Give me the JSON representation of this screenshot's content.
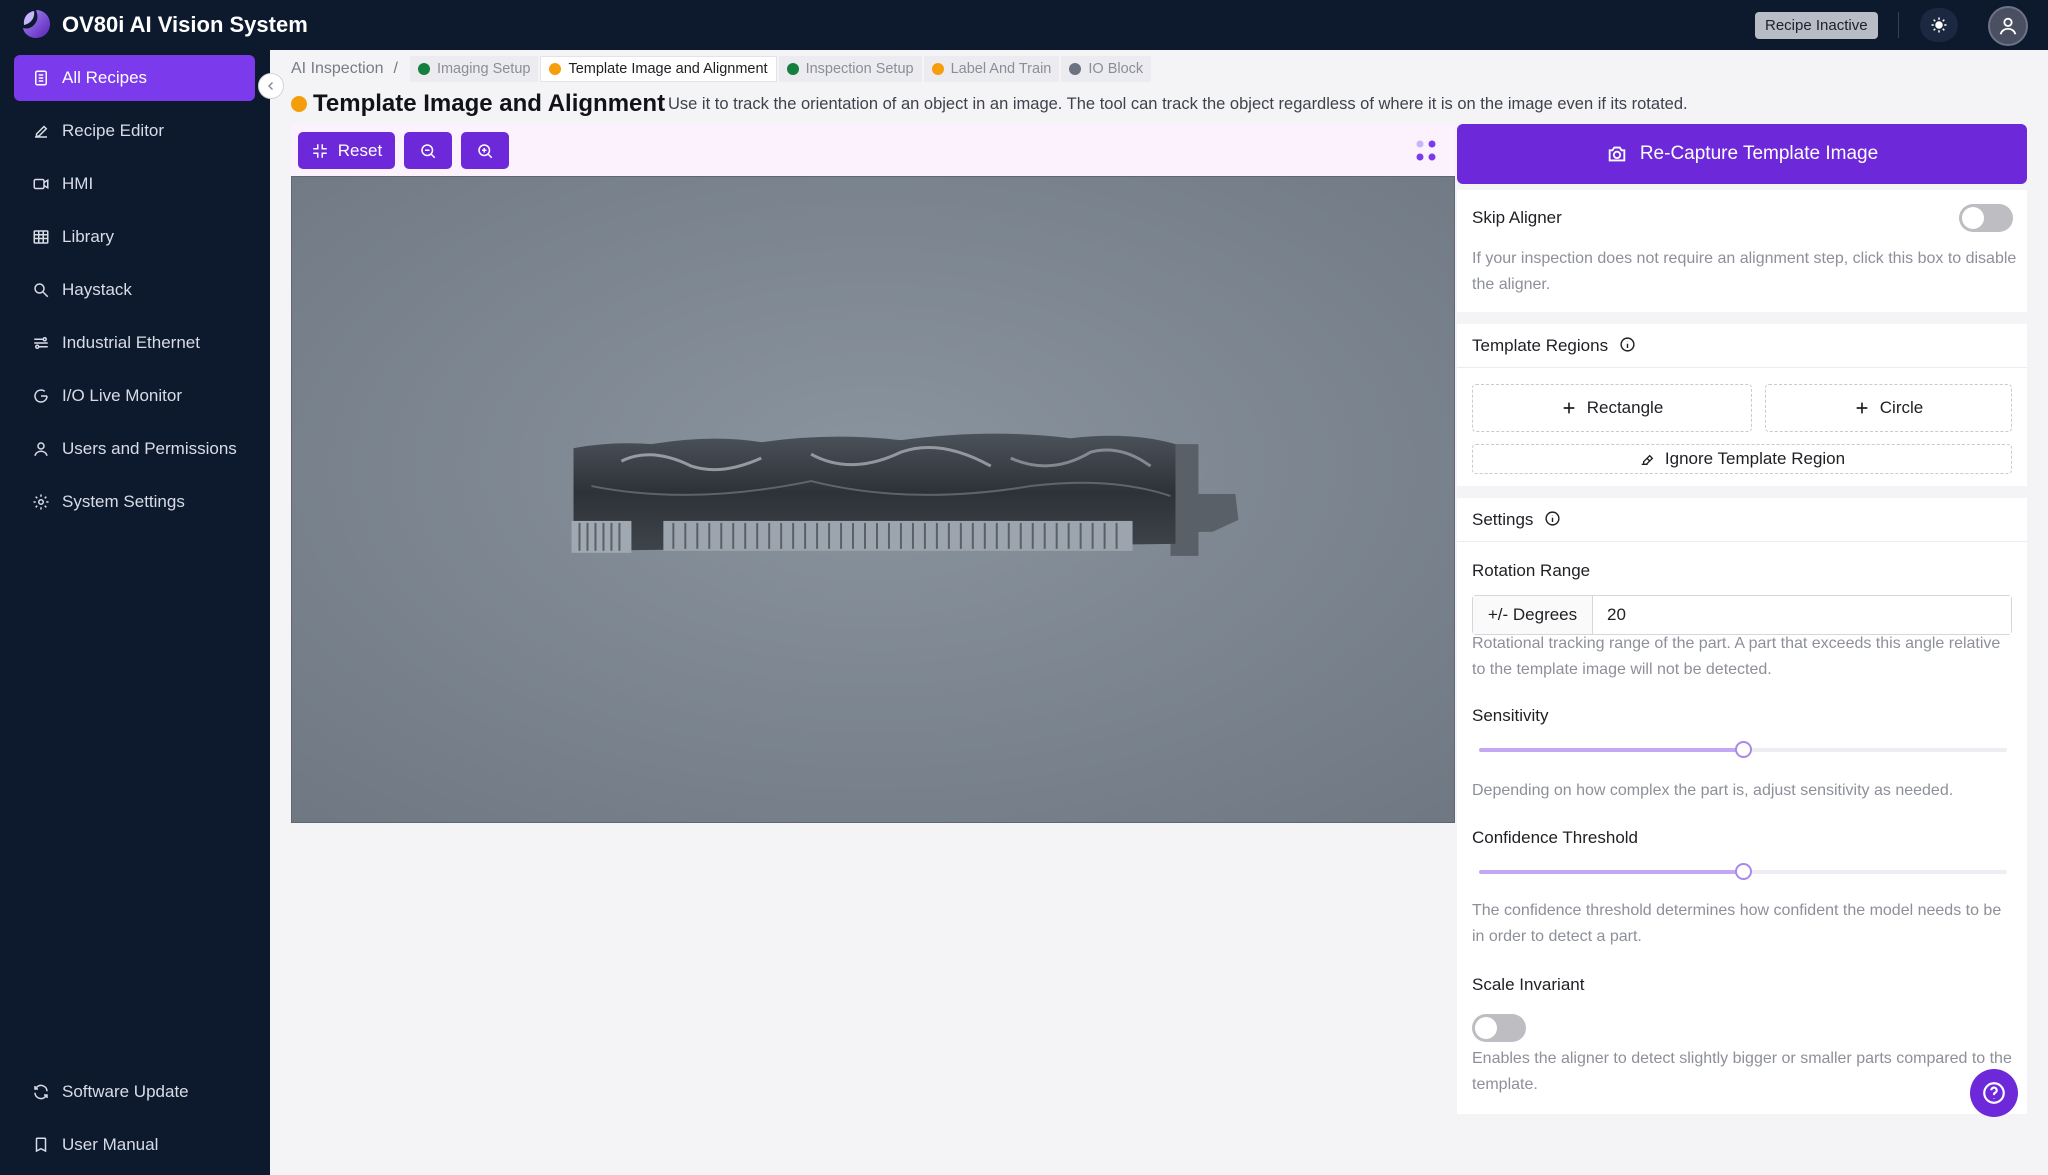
{
  "app": {
    "title": "OV80i AI Vision System",
    "recipe_status": "Recipe Inactive"
  },
  "sidebar": {
    "items": [
      {
        "label": "All Recipes",
        "icon": "document-icon",
        "active": true
      },
      {
        "label": "Recipe Editor",
        "icon": "pencil-icon"
      },
      {
        "label": "HMI",
        "icon": "video-icon"
      },
      {
        "label": "Library",
        "icon": "table-icon"
      },
      {
        "label": "Haystack",
        "icon": "search-icon"
      },
      {
        "label": "Industrial Ethernet",
        "icon": "network-icon"
      },
      {
        "label": "I/O Live Monitor",
        "icon": "monitor-icon"
      },
      {
        "label": "Users and Permissions",
        "icon": "user-icon"
      },
      {
        "label": "System Settings",
        "icon": "gear-icon"
      }
    ],
    "bottom_items": [
      {
        "label": "Software Update",
        "icon": "refresh-icon"
      },
      {
        "label": "User Manual",
        "icon": "book-icon"
      }
    ]
  },
  "breadcrumb": {
    "root": "AI Inspection",
    "separator": "/",
    "steps": [
      {
        "label": "Imaging Setup",
        "status_color": "#15803d"
      },
      {
        "label": "Template Image and Alignment",
        "status_color": "#f59e0b",
        "current": true
      },
      {
        "label": "Inspection Setup",
        "status_color": "#15803d"
      },
      {
        "label": "Label And Train",
        "status_color": "#f59e0b"
      },
      {
        "label": "IO Block",
        "status_color": "#6b7280"
      }
    ]
  },
  "page": {
    "title": "Template Image and Alignment",
    "status_color": "#f59e0b",
    "description": "Use it to track the orientation of an object in an image. The tool can track the object regardless of where it is on the image even if its rotated."
  },
  "toolbar": {
    "reset_label": "Reset"
  },
  "panel": {
    "capture_label": "Re-Capture Template Image",
    "skip_aligner": {
      "label": "Skip Aligner",
      "enabled": false,
      "help": "If your inspection does not require an alignment step, click this box to disable the aligner."
    },
    "template_regions": {
      "label": "Template Regions",
      "rectangle_label": "Rectangle",
      "circle_label": "Circle",
      "ignore_label": "Ignore Template Region"
    },
    "settings": {
      "label": "Settings",
      "rotation_range": {
        "label": "Rotation Range",
        "addon": "+/- Degrees",
        "value": "20",
        "help": "Rotational tracking range of the part. A part that exceeds this angle relative to the template image will not be detected."
      },
      "sensitivity": {
        "label": "Sensitivity",
        "fraction": 0.5,
        "help": "Depending on how complex the part is, adjust sensitivity as needed."
      },
      "confidence_threshold": {
        "label": "Confidence Threshold",
        "fraction": 0.5,
        "help": "The confidence threshold determines how confident the model needs to be in order to detect a part."
      },
      "scale_invariant": {
        "label": "Scale Invariant",
        "enabled": false,
        "help": "Enables the aligner to detect slightly bigger or smaller parts compared to the template."
      }
    }
  },
  "colors": {
    "accent": "#6d28d9",
    "sidebar_bg": "#0d1a2e",
    "active_nav": "#7c3aed"
  }
}
